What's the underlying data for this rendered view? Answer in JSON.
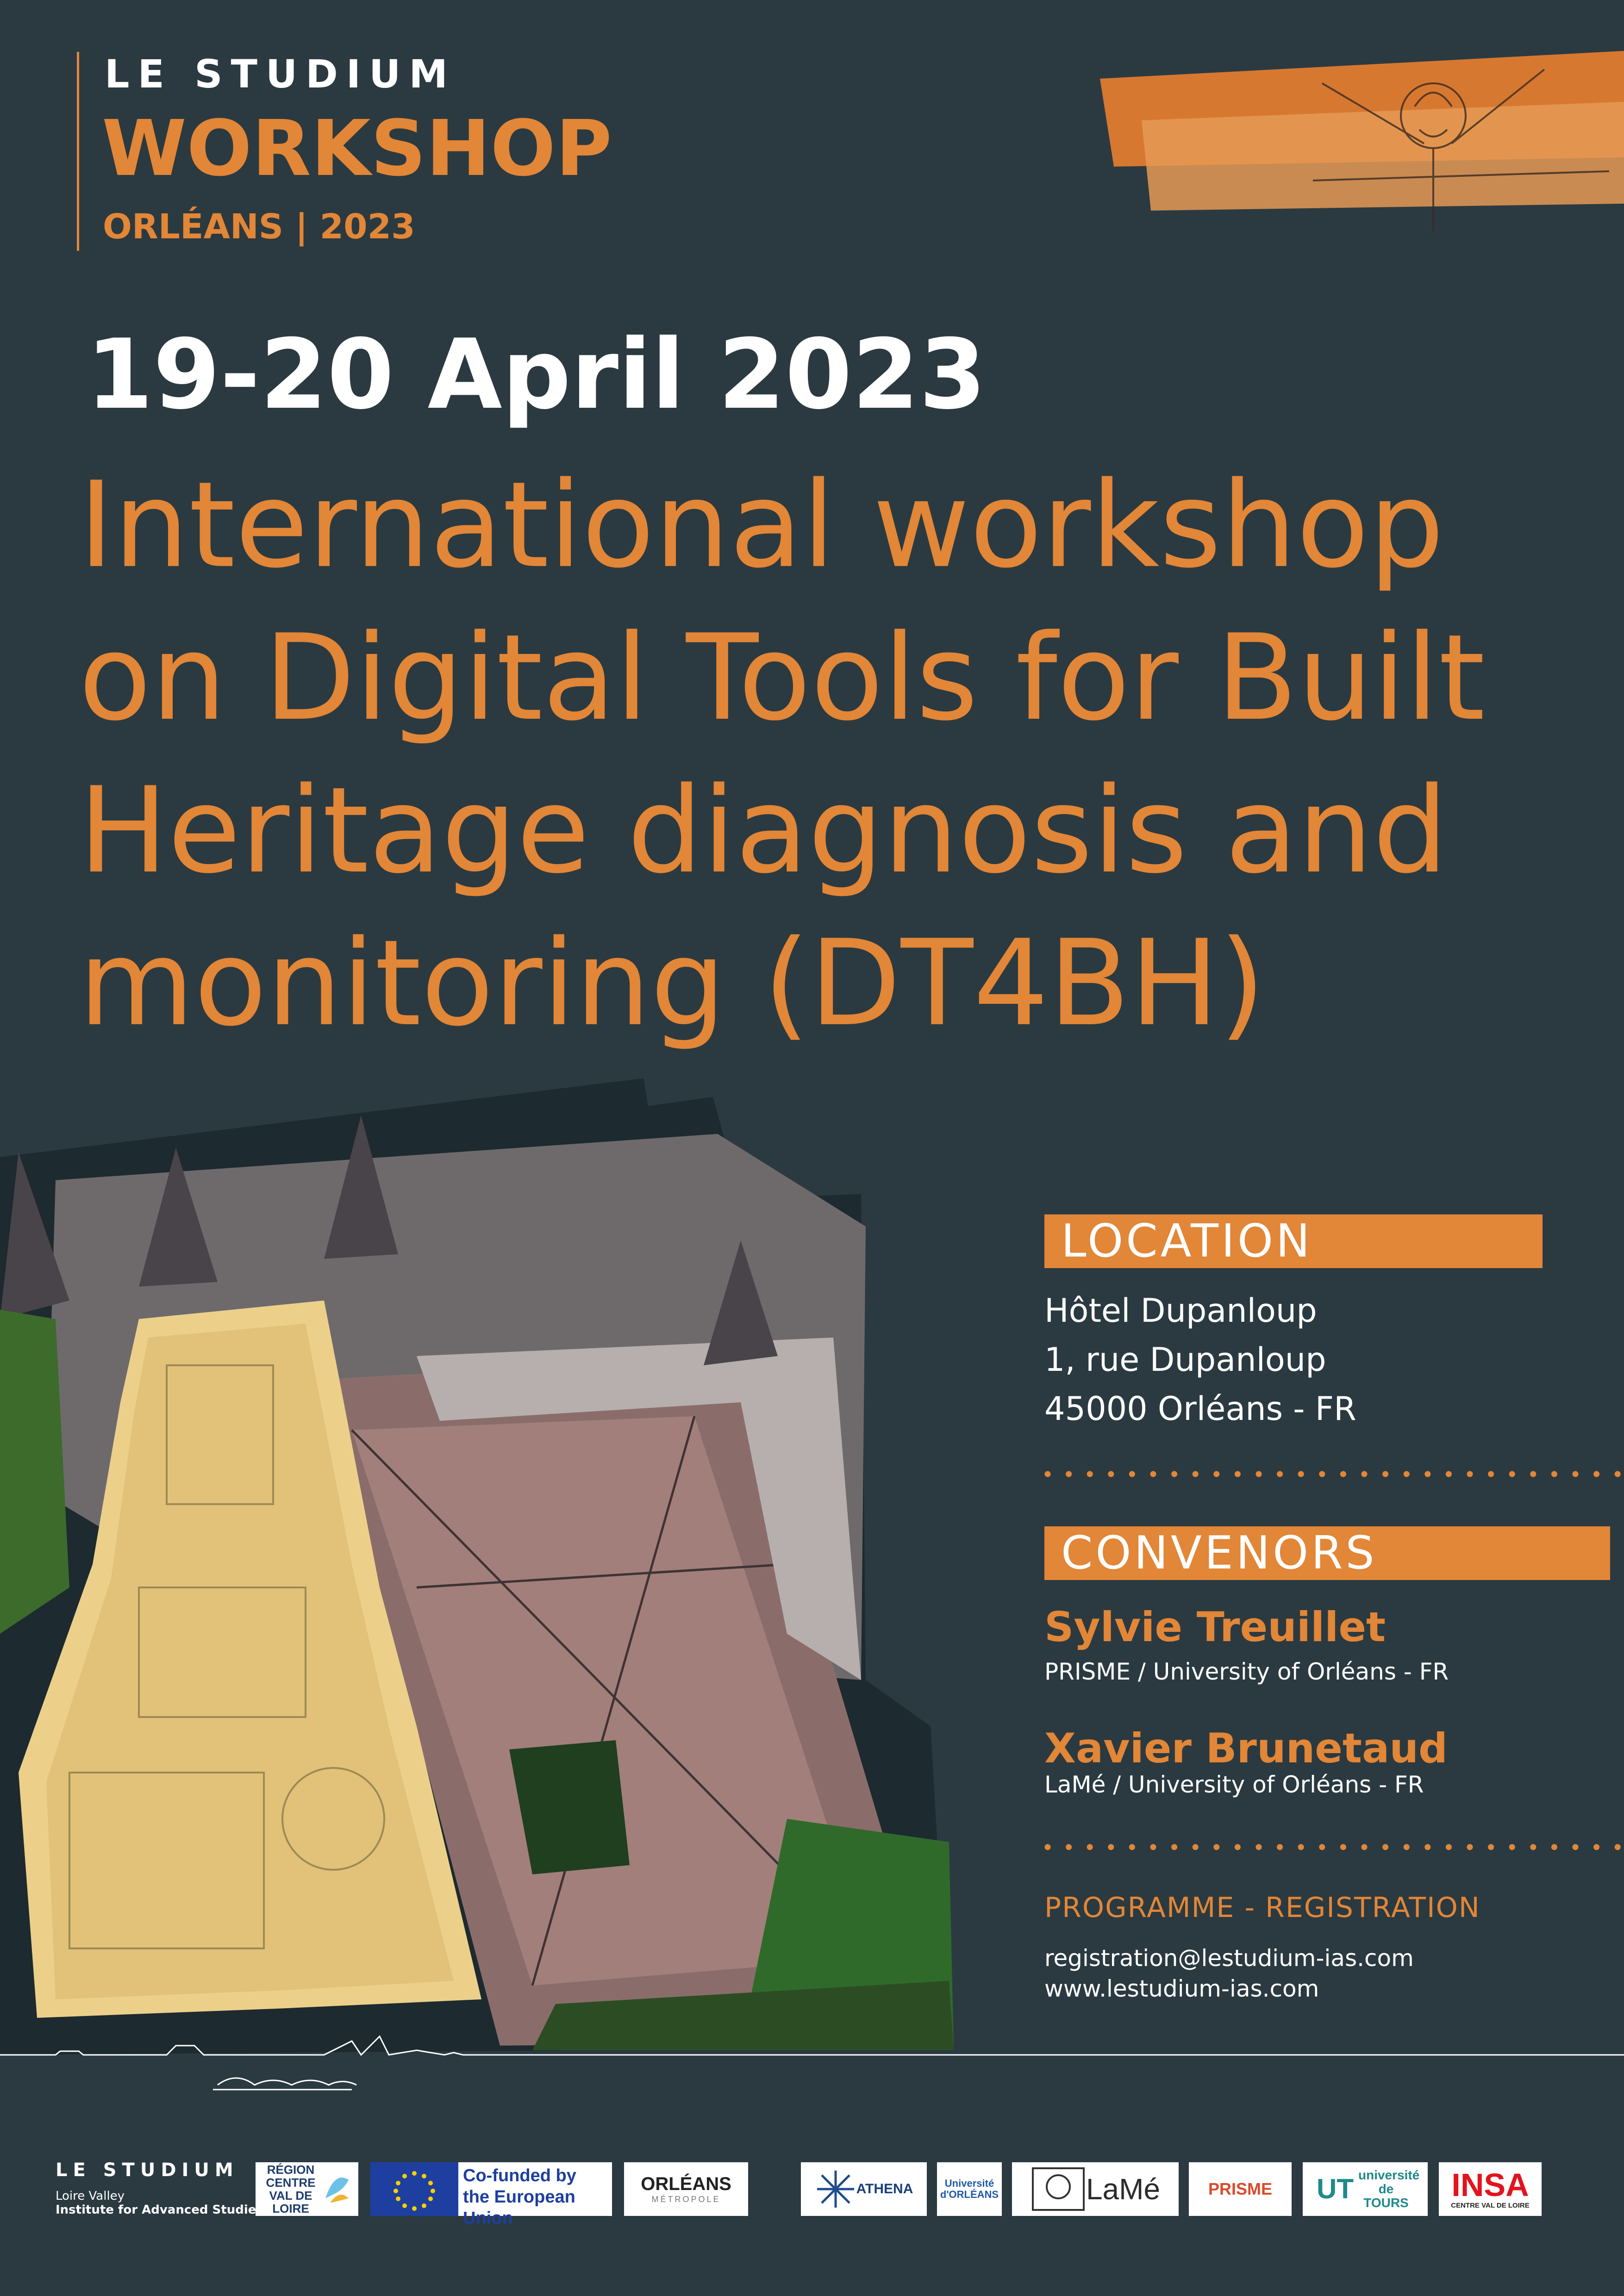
{
  "brand": {
    "top": "LE STUDIUM",
    "workshop": "WORKSHOP",
    "place_year": "ORLÉANS | 2023"
  },
  "event": {
    "date": "19-20 April 2023",
    "title": "International workshop on Digital Tools for Built Heritage diagnosis and monitoring (DT4BH)"
  },
  "location": {
    "heading": "LOCATION",
    "lines": [
      "Hôtel Dupanloup",
      "1, rue Dupanloup",
      "45000 Orléans - FR"
    ]
  },
  "convenors": {
    "heading": "CONVENORS",
    "people": [
      {
        "name": "Sylvie Treuillet",
        "affiliation": "PRISME / University of Orléans - FR"
      },
      {
        "name": "Xavier Brunetaud",
        "affiliation": "LaMé / University of Orléans - FR"
      }
    ]
  },
  "programme": {
    "heading": "PROGRAMME - REGISTRATION",
    "email": "registration@lestudium-ias.com",
    "website": "www.lestudium-ias.com"
  },
  "footer": {
    "studium": "LE STUDIUM",
    "studium_sub_1": "Loire Valley",
    "studium_sub_2": "Institute for Advanced Studies",
    "logos": {
      "region": "RÉGION CENTRE VAL DE LOIRE",
      "eu": "Co-funded by the European Union",
      "orleans": "ORLÉANS",
      "orleans_sub": "MÉTROPOLE",
      "athena": "ATHENA",
      "univ_orleans": "Université d'ORLÉANS",
      "lame": "LaMé",
      "prisme": "PRISME",
      "tours": "université de TOURS",
      "insa": "INSA",
      "insa_sub": "CENTRE VAL DE LOIRE"
    }
  },
  "colors": {
    "background": "#2b3a41",
    "accent": "#e28637",
    "text": "#ffffff"
  }
}
